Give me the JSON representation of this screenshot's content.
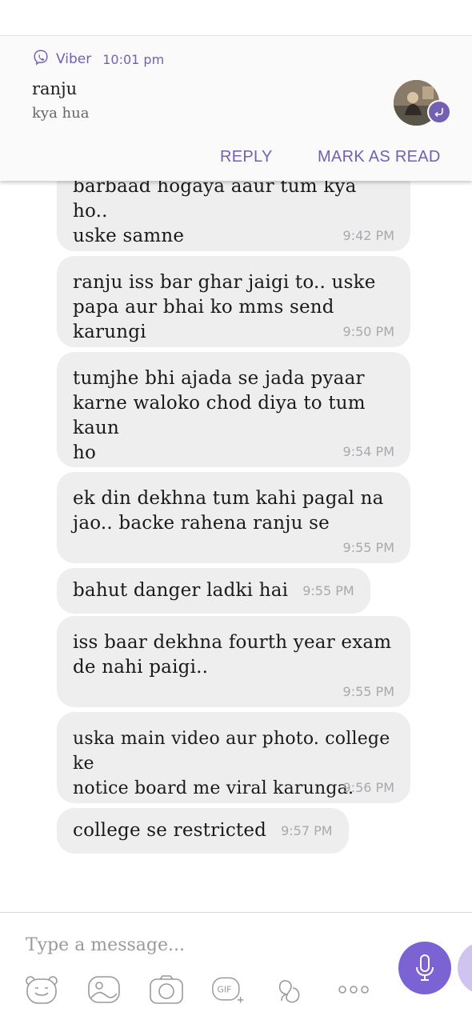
{
  "notification": {
    "app_name": "Viber",
    "time": "10:01 pm",
    "sender": "ranju",
    "preview": "kya hua",
    "reply_label": "REPLY",
    "mark_read_label": "MARK AS READ",
    "accent": "#7360b2"
  },
  "messages": [
    {
      "text": "barbaad hogaya aaur tum kya ho..\nuske samne",
      "time": "9:42 PM"
    },
    {
      "text": "ranju iss bar ghar jaigi to.. uske\npapa aur bhai ko mms send karungi",
      "time": "9:50 PM"
    },
    {
      "text": "tumjhe bhi ajada se jada pyaar\nkarne waloko chod diya to tum kaun\nho",
      "time": "9:54 PM"
    },
    {
      "text": "ek din dekhna tum kahi pagal na\njao.. backe rahena ranju se",
      "time": "9:55 PM"
    },
    {
      "text": "bahut danger ladki hai",
      "time": "9:55 PM"
    },
    {
      "text": "iss baar dekhna fourth year exam\nde nahi paigi..",
      "time": "9:55 PM"
    },
    {
      "text": "uska main video aur photo. college ke\nnotice board me viral karunga.",
      "time": "9:56 PM"
    },
    {
      "text": "college se restricted",
      "time": "9:57 PM"
    }
  ],
  "composer": {
    "placeholder": "Type a message...",
    "gif_label": "GIF",
    "accent": "#7b63d3",
    "tools": [
      "sticker-icon",
      "gallery-icon",
      "camera-icon",
      "gif-icon",
      "doodle-icon",
      "more-icon",
      "microphone-icon"
    ]
  }
}
